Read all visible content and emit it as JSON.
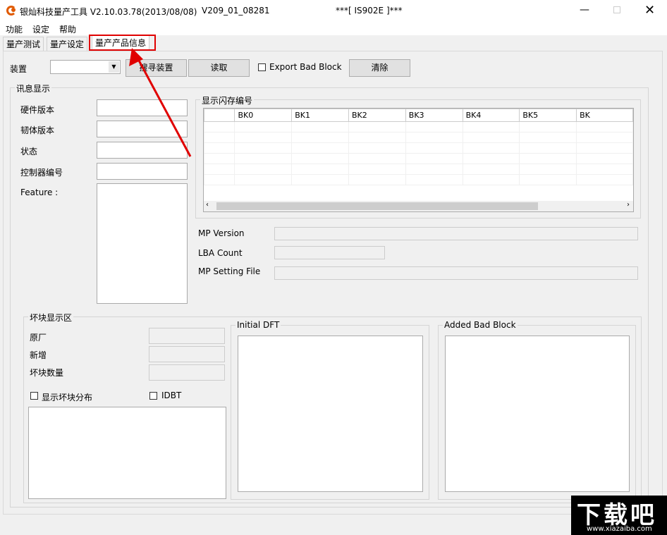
{
  "window": {
    "title": "银灿科技量产工具 V2.10.03.78(2013/08/08)",
    "version": "V209_01_08281",
    "chip": "***[ IS902E ]***",
    "icon": "app-logo-icon"
  },
  "menu": [
    "功能",
    "设定",
    "帮助"
  ],
  "tabs": [
    {
      "label": "量产测试"
    },
    {
      "label": "量产设定"
    },
    {
      "label": "量产产品信息",
      "active": true
    }
  ],
  "toolbar": {
    "device_label": "装置",
    "device_value": "",
    "search_button": "搜寻装置",
    "read_button": "读取",
    "export_bad_block": "Export Bad Block",
    "export_checked": false,
    "clear_button": "清除"
  },
  "info": {
    "group": "讯息显示",
    "hardware": "硬件版本",
    "firmware": "韧体版本",
    "status": "状态",
    "controller": "控制器编号",
    "feature": "Feature :"
  },
  "flash": {
    "group": "显示闪存编号",
    "columns": [
      "",
      "BK0",
      "BK1",
      "BK2",
      "BK3",
      "BK4",
      "BK5",
      "BK"
    ]
  },
  "mp": {
    "version": "MP Version",
    "lba": "LBA Count",
    "setting": "MP Setting File"
  },
  "badblock": {
    "group": "坏块显示区",
    "original": "原厂",
    "added": "新增",
    "count": "坏块数量",
    "show_dist": "显示坏块分布",
    "idbt": "IDBT",
    "initial_dft": "Initial DFT",
    "added_bad_block": "Added Bad Block"
  },
  "watermark": {
    "text": "下载吧",
    "url": "www.xiazaiba.com"
  },
  "colors": {
    "highlight": "#e00000"
  }
}
